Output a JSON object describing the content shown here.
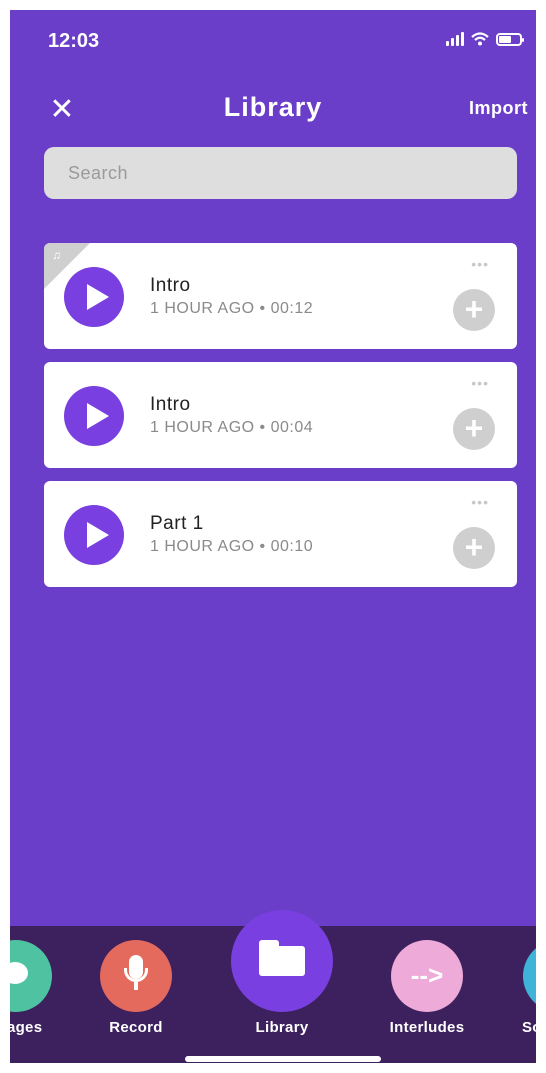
{
  "status_bar": {
    "time": "12:03"
  },
  "header": {
    "close_icon": "close-icon",
    "title": "Library",
    "import_label": "Import"
  },
  "search": {
    "placeholder": "Search"
  },
  "recordings": [
    {
      "title": "Intro",
      "meta": "1 HOUR AGO • 00:12",
      "has_music_badge": true
    },
    {
      "title": "Intro",
      "meta": "1 HOUR AGO • 00:04",
      "has_music_badge": false
    },
    {
      "title": "Part 1",
      "meta": "1 HOUR AGO • 00:10",
      "has_music_badge": false
    }
  ],
  "card_more_symbol": "•••",
  "card_add_symbol": "+",
  "music_badge_symbol": "♫",
  "tabbar": {
    "tabs": [
      {
        "label": "ssages",
        "icon": "chat-bubble-icon",
        "color": "#4fc3a1"
      },
      {
        "label": "Record",
        "icon": "microphone-icon",
        "color": "#e46a5e"
      },
      {
        "label": "Library",
        "icon": "folder-icon",
        "color": "#7a3fe0",
        "active": true
      },
      {
        "label": "Interludes",
        "icon": "arrow-right-icon",
        "color": "#eeaad8"
      },
      {
        "label": "So",
        "icon": "sound-icon",
        "color": "#3fb4d6"
      }
    ],
    "interludes_glyph": "-->"
  },
  "colors": {
    "background": "#6a3ec8",
    "tabbar": "#3d215f",
    "accent": "#7a3fe0"
  }
}
